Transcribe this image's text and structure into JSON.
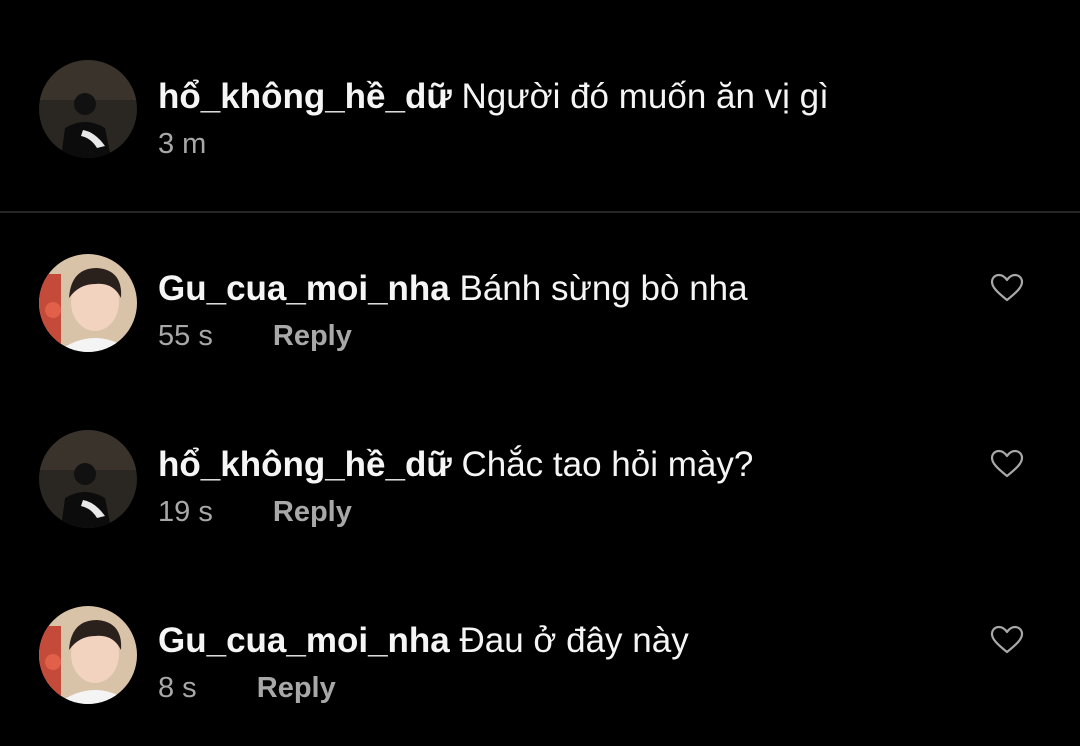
{
  "caption": {
    "username": "hổ_không_hề_dữ",
    "text": "Người đó muốn ăn vị gì",
    "time": "3 m"
  },
  "comments": [
    {
      "username": "Gu_cua_moi_nha",
      "text": "Bánh sừng bò nha",
      "time": "55 s",
      "reply_label": "Reply",
      "avatar": "avatar-gu-cua-moi-nha"
    },
    {
      "username": "hổ_không_hề_dữ",
      "text": "Chắc tao hỏi mày?",
      "time": "19 s",
      "reply_label": "Reply",
      "avatar": "avatar-ho-khong-he-du"
    },
    {
      "username": "Gu_cua_moi_nha",
      "text": "Đau ở đây này",
      "time": "8 s",
      "reply_label": "Reply",
      "avatar": "avatar-gu-cua-moi-nha"
    }
  ],
  "icons": {
    "like": "heart-outline-icon"
  },
  "colors": {
    "background": "#000000",
    "primary_text": "#f5f5f5",
    "secondary_text": "#a8a8a8",
    "divider": "#262626"
  }
}
